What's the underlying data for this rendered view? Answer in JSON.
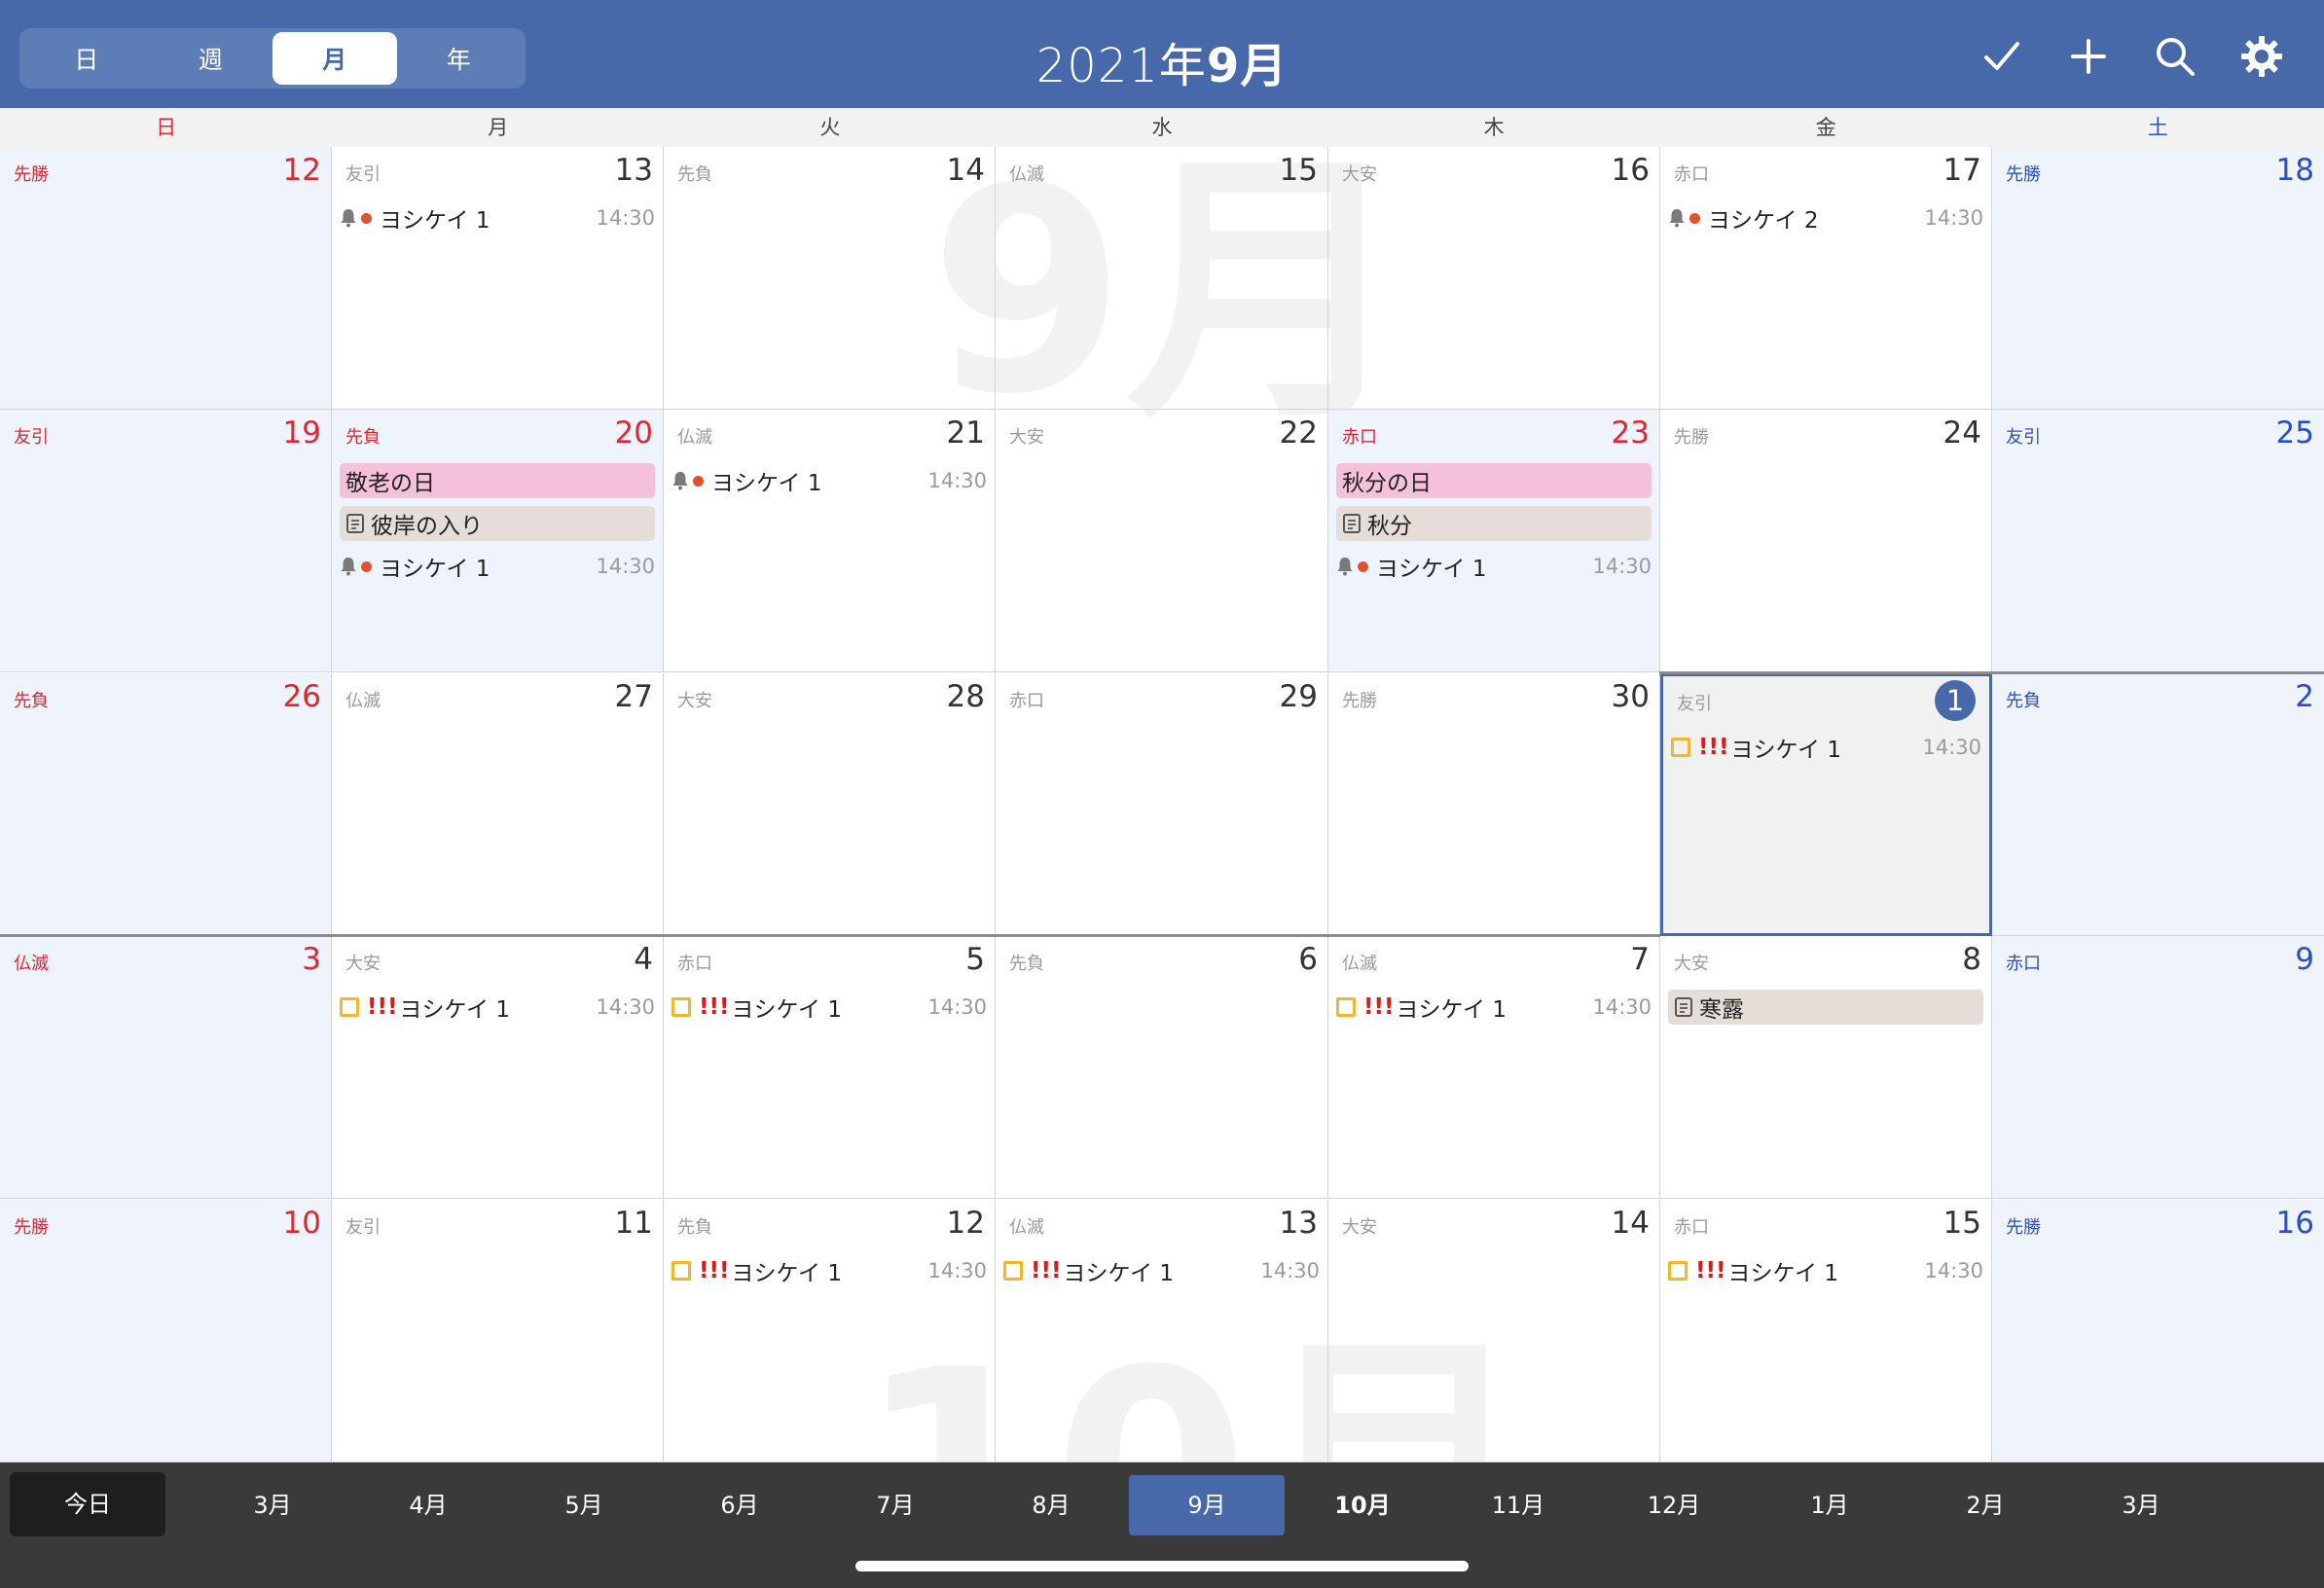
{
  "header": {
    "view_segments": [
      "日",
      "週",
      "月",
      "年"
    ],
    "active_segment": "月",
    "title_year": "2021年",
    "title_month": "9月"
  },
  "weekdays": [
    "日",
    "月",
    "火",
    "水",
    "木",
    "金",
    "土"
  ],
  "watermarks": [
    "9月",
    "10月"
  ],
  "weeks": [
    [
      {
        "rokuyo": "先勝",
        "day": "12",
        "type": "sun",
        "events": []
      },
      {
        "rokuyo": "友引",
        "day": "13",
        "events": [
          {
            "kind": "alarm",
            "title": "ヨシケイ 1",
            "time": "14:30"
          }
        ]
      },
      {
        "rokuyo": "先負",
        "day": "14",
        "events": []
      },
      {
        "rokuyo": "仏滅",
        "day": "15",
        "events": []
      },
      {
        "rokuyo": "大安",
        "day": "16",
        "events": []
      },
      {
        "rokuyo": "赤口",
        "day": "17",
        "events": [
          {
            "kind": "alarm",
            "title": "ヨシケイ 2",
            "time": "14:30"
          }
        ]
      },
      {
        "rokuyo": "先勝",
        "day": "18",
        "type": "sat",
        "events": []
      }
    ],
    [
      {
        "rokuyo": "友引",
        "day": "19",
        "type": "sun",
        "events": []
      },
      {
        "rokuyo": "先負",
        "day": "20",
        "type": "hol",
        "events": [
          {
            "kind": "holiday",
            "title": "敬老の日"
          },
          {
            "kind": "note",
            "title": "彼岸の入り"
          },
          {
            "kind": "alarm",
            "title": "ヨシケイ 1",
            "time": "14:30"
          }
        ]
      },
      {
        "rokuyo": "仏滅",
        "day": "21",
        "events": [
          {
            "kind": "alarm",
            "title": "ヨシケイ 1",
            "time": "14:30"
          }
        ]
      },
      {
        "rokuyo": "大安",
        "day": "22",
        "events": []
      },
      {
        "rokuyo": "赤口",
        "day": "23",
        "type": "hol",
        "events": [
          {
            "kind": "holiday",
            "title": "秋分の日"
          },
          {
            "kind": "note",
            "title": "秋分"
          },
          {
            "kind": "alarm",
            "title": "ヨシケイ 1",
            "time": "14:30"
          }
        ]
      },
      {
        "rokuyo": "先勝",
        "day": "24",
        "events": []
      },
      {
        "rokuyo": "友引",
        "day": "25",
        "type": "sat",
        "events": []
      }
    ],
    [
      {
        "rokuyo": "先負",
        "day": "26",
        "type": "sun",
        "events": []
      },
      {
        "rokuyo": "仏滅",
        "day": "27",
        "events": []
      },
      {
        "rokuyo": "大安",
        "day": "28",
        "events": []
      },
      {
        "rokuyo": "赤口",
        "day": "29",
        "events": []
      },
      {
        "rokuyo": "先勝",
        "day": "30",
        "events": []
      },
      {
        "rokuyo": "友引",
        "day": "1",
        "type": "today",
        "events": [
          {
            "kind": "task",
            "title": "ヨシケイ 1",
            "time": "14:30"
          }
        ]
      },
      {
        "rokuyo": "先負",
        "day": "2",
        "type": "sat",
        "events": []
      }
    ],
    [
      {
        "rokuyo": "仏滅",
        "day": "3",
        "type": "sun",
        "events": []
      },
      {
        "rokuyo": "大安",
        "day": "4",
        "events": [
          {
            "kind": "task",
            "title": "ヨシケイ 1",
            "time": "14:30"
          }
        ]
      },
      {
        "rokuyo": "赤口",
        "day": "5",
        "events": [
          {
            "kind": "task",
            "title": "ヨシケイ 1",
            "time": "14:30"
          }
        ]
      },
      {
        "rokuyo": "先負",
        "day": "6",
        "events": []
      },
      {
        "rokuyo": "仏滅",
        "day": "7",
        "events": [
          {
            "kind": "task",
            "title": "ヨシケイ 1",
            "time": "14:30"
          }
        ]
      },
      {
        "rokuyo": "大安",
        "day": "8",
        "events": [
          {
            "kind": "note",
            "title": "寒露"
          }
        ]
      },
      {
        "rokuyo": "赤口",
        "day": "9",
        "type": "sat",
        "events": []
      }
    ],
    [
      {
        "rokuyo": "先勝",
        "day": "10",
        "type": "sun",
        "events": []
      },
      {
        "rokuyo": "友引",
        "day": "11",
        "events": []
      },
      {
        "rokuyo": "先負",
        "day": "12",
        "events": [
          {
            "kind": "task",
            "title": "ヨシケイ 1",
            "time": "14:30"
          }
        ]
      },
      {
        "rokuyo": "仏滅",
        "day": "13",
        "events": [
          {
            "kind": "task",
            "title": "ヨシケイ 1",
            "time": "14:30"
          }
        ]
      },
      {
        "rokuyo": "大安",
        "day": "14",
        "events": []
      },
      {
        "rokuyo": "赤口",
        "day": "15",
        "events": [
          {
            "kind": "task",
            "title": "ヨシケイ 1",
            "time": "14:30"
          }
        ]
      },
      {
        "rokuyo": "先勝",
        "day": "16",
        "type": "sat",
        "events": []
      }
    ]
  ],
  "task_marker": "!!!",
  "bottom": {
    "today_label": "今日",
    "months": [
      "3月",
      "4月",
      "5月",
      "6月",
      "7月",
      "8月",
      "9月",
      "10月",
      "11月",
      "12月",
      "1月",
      "2月",
      "3月"
    ],
    "current_month": "9月",
    "next_month": "10月"
  },
  "colors": {
    "header_bg": "#4869a9",
    "sunday": "#e0262f",
    "saturday": "#2a4fc4",
    "holiday_event": "#f4c0da",
    "note_event": "#e5ddd7",
    "task_box": "#f2b72d"
  }
}
